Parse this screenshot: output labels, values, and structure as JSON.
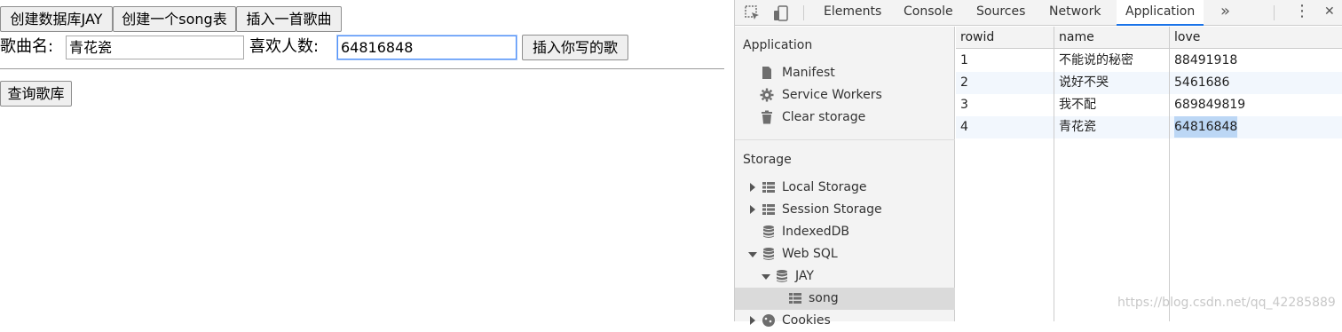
{
  "page": {
    "buttons": {
      "create_db": "创建数据库JAY",
      "create_table": "创建一个song表",
      "insert_song": "插入一首歌曲",
      "insert_yours": "插入你写的歌",
      "query": "查询歌库"
    },
    "song_name_label": "歌曲名:",
    "song_name_value": "青花瓷",
    "likes_label": "喜欢人数:",
    "likes_value": "64816848"
  },
  "devtools": {
    "tabs": [
      "Elements",
      "Console",
      "Sources",
      "Network",
      "Application"
    ],
    "active_tab": "Application",
    "more_tabs_glyph": "»",
    "menu_glyph": "⋮",
    "close_glyph": "✕",
    "sidebar": {
      "application_title": "Application",
      "application_items": [
        {
          "label": "Manifest",
          "icon": "file-icon"
        },
        {
          "label": "Service Workers",
          "icon": "gear-icon"
        },
        {
          "label": "Clear storage",
          "icon": "trash-icon"
        }
      ],
      "storage_title": "Storage",
      "storage_items": [
        {
          "label": "Local Storage",
          "icon": "grid-icon",
          "expanded": false
        },
        {
          "label": "Session Storage",
          "icon": "grid-icon",
          "expanded": false
        },
        {
          "label": "IndexedDB",
          "icon": "database-icon"
        },
        {
          "label": "Web SQL",
          "icon": "database-icon",
          "expanded": true
        },
        {
          "label": "JAY",
          "icon": "database-icon",
          "expanded": true
        },
        {
          "label": "song",
          "icon": "grid-icon",
          "selected": true
        },
        {
          "label": "Cookies",
          "icon": "cookie-icon",
          "expanded": false
        }
      ]
    },
    "table": {
      "columns": [
        "rowid",
        "name",
        "love"
      ],
      "rows": [
        [
          "1",
          "不能说的秘密",
          "88491918"
        ],
        [
          "2",
          "说好不哭",
          "5461686"
        ],
        [
          "3",
          "我不配",
          "689849819"
        ],
        [
          "4",
          "青花瓷",
          "64816848"
        ]
      ],
      "highlight_color": "#bcd7f5"
    }
  },
  "watermark": "https://blog.csdn.net/qq_42285889",
  "colors": {
    "accent": "#1a73e8",
    "toolbar_bg": "#f3f3f3",
    "selected_row": "#dadada"
  }
}
